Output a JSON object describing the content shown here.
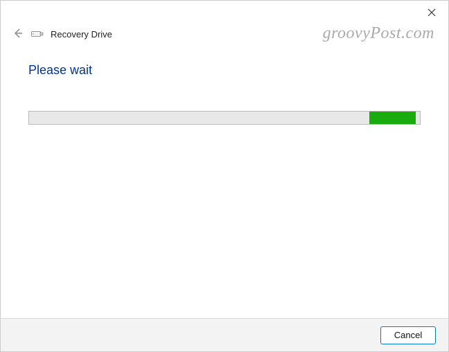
{
  "titlebar": {
    "close_icon": "close"
  },
  "header": {
    "back_icon": "back-arrow",
    "drive_icon": "usb-drive",
    "app_title": "Recovery Drive"
  },
  "content": {
    "heading": "Please wait",
    "progress": {
      "indeterminate": true,
      "fill_start_percent": 87,
      "fill_width_percent": 12,
      "fill_color": "#1aab0f",
      "track_color": "#e8e8e8"
    }
  },
  "footer": {
    "cancel_label": "Cancel"
  },
  "watermark": "groovyPost.com"
}
